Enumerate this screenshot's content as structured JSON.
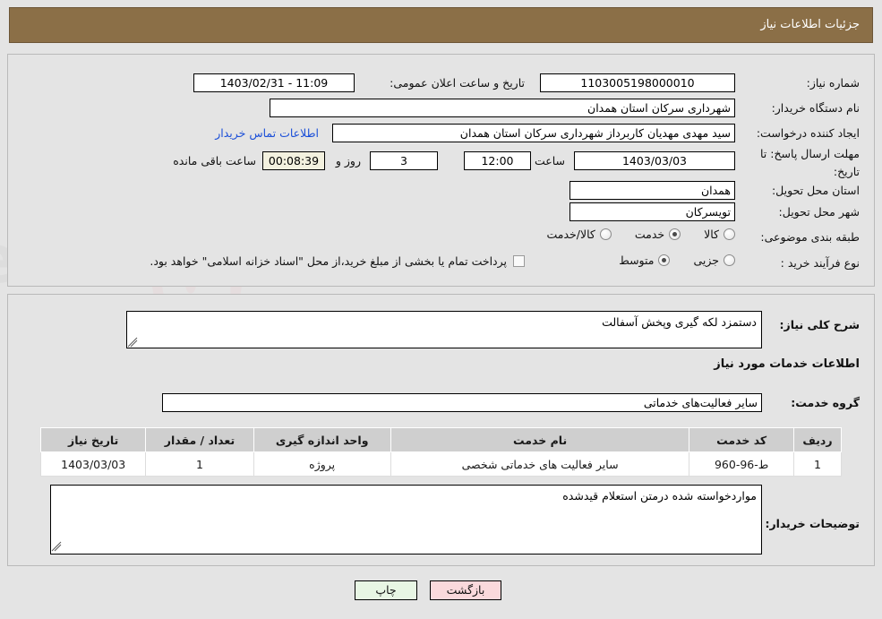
{
  "header": {
    "title": "جزئیات اطلاعات نیاز"
  },
  "top_panel": {
    "need_number_label": "شماره نیاز:",
    "need_number_value": "1103005198000010",
    "announce_label": "تاریخ و ساعت اعلان عمومی:",
    "announce_value": "11:09 - 1403/02/31",
    "buyer_org_label": "نام دستگاه خریدار:",
    "buyer_org_value": "شهرداری سرکان استان همدان",
    "creator_label": "ایجاد کننده درخواست:",
    "creator_value": "سید مهدی مهدیان کاربرداز شهرداری سرکان استان همدان",
    "contact_link": "اطلاعات تماس خریدار",
    "deadline_label_line1": "مهلت ارسال پاسخ: تا",
    "deadline_label_line2": "تاریخ:",
    "deadline_date": "1403/03/03",
    "hour_label": "ساعت",
    "deadline_time": "12:00",
    "days_left": "3",
    "days_word": "روز و",
    "timer_value": "00:08:39",
    "remaining_word": "ساعت باقی مانده",
    "province_label": "استان محل تحویل:",
    "province_value": "همدان",
    "city_label": "شهر محل تحویل:",
    "city_value": "تویسرکان",
    "category_label": "طبقه بندی موضوعی:",
    "category_options": [
      {
        "label": "کالا",
        "selected": false
      },
      {
        "label": "خدمت",
        "selected": true
      },
      {
        "label": "کالا/خدمت",
        "selected": false
      }
    ],
    "process_label": "نوع فرآیند خرید :",
    "process_options": [
      {
        "label": "جزیی",
        "selected": false
      },
      {
        "label": "متوسط",
        "selected": true
      }
    ],
    "treasury_checkbox": {
      "checked": false,
      "text": "پرداخت تمام یا بخشی از مبلغ خرید،از محل \"اسناد خزانه اسلامی\" خواهد بود."
    }
  },
  "middle_panel": {
    "general_desc_label": "شرح کلی نیاز:",
    "general_desc_value": "دستمزد لکه گیری وپخش آسفالت",
    "services_heading": "اطلاعات خدمات مورد نیاز",
    "service_group_label": "گروه خدمت:",
    "service_group_value": "سایر فعالیت‌های خدماتی",
    "table": {
      "columns": [
        "ردیف",
        "کد خدمت",
        "نام خدمت",
        "واحد اندازه گیری",
        "تعداد / مقدار",
        "تاریخ نیاز"
      ],
      "rows": [
        {
          "row": "1",
          "service_code": "ط-96-960",
          "service_name": "سایر فعالیت های خدماتی شخصی",
          "unit": "پروژه",
          "quantity": "1",
          "need_date": "1403/03/03"
        }
      ]
    },
    "buyer_notes_label": "توضیحات خریدار:",
    "buyer_notes_value": "مواردخواسته شده درمتن استعلام قیدشده"
  },
  "footer": {
    "print_label": "چاپ",
    "back_label": "بازگشت"
  },
  "watermark": {
    "text": "AriaTender.ir"
  },
  "colors": {
    "header_bg": "#8b6f47",
    "page_bg": "#e4e4e4",
    "link": "#1b4fd8",
    "timer_bg": "#f3f1df",
    "table_head_bg": "#cfcfcf",
    "print_btn_bg": "#e8f6e4",
    "back_btn_bg": "#fad9dc"
  }
}
